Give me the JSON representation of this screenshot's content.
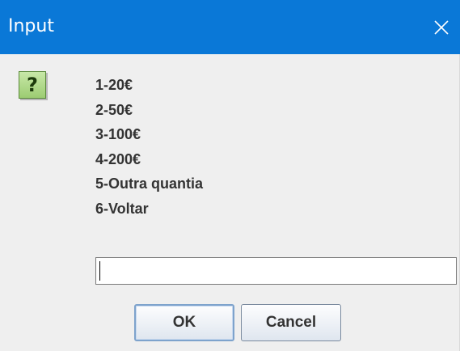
{
  "window": {
    "title": "Input",
    "titlebar_color": "#0a78d7",
    "close_icon": "close-icon"
  },
  "dialog": {
    "icon": "question-icon",
    "icon_glyph": "?",
    "options": [
      "1-20€",
      "2-50€",
      "3-100€",
      "4-200€",
      "5-Outra quantia",
      "6-Voltar"
    ],
    "input": {
      "value": "",
      "placeholder": ""
    },
    "buttons": {
      "ok": "OK",
      "cancel": "Cancel"
    }
  }
}
